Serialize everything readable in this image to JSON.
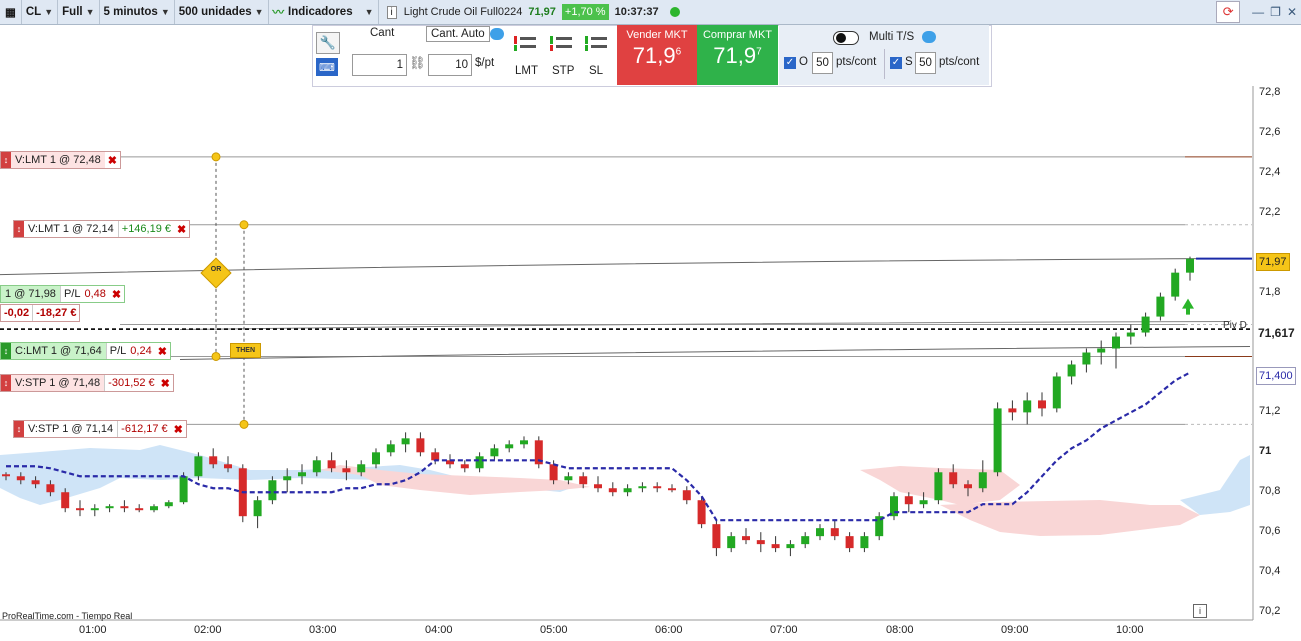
{
  "toolbar": {
    "symbol": "CL",
    "view": "Full",
    "timeframe": "5 minutos",
    "units": "500 unidades",
    "indicators": "Indicadores",
    "instrument": "Light Crude Oil Full0224",
    "price": "71,97",
    "change": "+1,70 %",
    "time": "10:37:37"
  },
  "order_panel": {
    "cant_label": "Cant",
    "cant_auto_label": "Cant. Auto",
    "quantity": "1",
    "dollar_per_pt": "10",
    "dollar_per_pt_unit": "$/pt",
    "lmt_label": "LMT",
    "stp_label": "STP",
    "sl_label": "SL",
    "sell_label": "Vender MKT",
    "sell_price_main": "71,9",
    "sell_price_sup": "6",
    "buy_label": "Comprar MKT",
    "buy_price_main": "71,9",
    "buy_price_sup": "7",
    "multi_ts_label": "Multi T/S",
    "o_label": "O",
    "o_value": "50",
    "s_label": "S",
    "s_value": "50",
    "pts_cont": "pts/cont"
  },
  "orders": {
    "o1": "V:LMT  1  @  72,48",
    "o2": "V:LMT  1  @  72,14",
    "o2_pl": "+146,19 €",
    "pos_main": "1  @  71,98",
    "pos_pl_label": "P/L",
    "pos_pl": "0,48",
    "pos_pts": "-0,02",
    "pos_eur": "-18,27 €",
    "o3": "C:LMT  1  @  71,64",
    "o3_pl_label": "P/L",
    "o3_pl": "0,24",
    "o4": "V:STP  1  @  71,48",
    "o4_pl": "-301,52 €",
    "o5": "V:STP  1  @  71,14",
    "o5_pl": "-612,17 €",
    "or_label": "OR",
    "then_label": "THEN"
  },
  "y_axis": [
    "72,8",
    "72,6",
    "72,4",
    "72,2",
    "71,8",
    "71,2",
    "71",
    "70,8",
    "70,6",
    "70,4",
    "70,2"
  ],
  "price_tags": {
    "last": "71,97",
    "pivot": "71,617",
    "pivot_label": "Piv D",
    "stop_line": "71,400"
  },
  "x_axis": [
    "01:00",
    "02:00",
    "03:00",
    "04:00",
    "05:00",
    "06:00",
    "07:00",
    "08:00",
    "09:00",
    "10:00"
  ],
  "footer": "ProRealTime.com - Tiempo Real",
  "colors": {
    "up": "#22a822",
    "down": "#d62a2a",
    "cloud_blue": "#cfe4f7",
    "cloud_red": "#f9d6d6",
    "stop_line": "#2a2aa8",
    "accent": "#2a66c8"
  },
  "chart_data": {
    "type": "candlestick",
    "ylim": [
      70.2,
      72.8
    ],
    "candles": [
      [
        0,
        70.89,
        70.9,
        70.86,
        70.88
      ],
      [
        1,
        70.88,
        70.9,
        70.84,
        70.86
      ],
      [
        2,
        70.86,
        70.88,
        70.82,
        70.84
      ],
      [
        3,
        70.84,
        70.86,
        70.78,
        70.8
      ],
      [
        4,
        70.8,
        70.82,
        70.7,
        70.72
      ],
      [
        5,
        70.72,
        70.76,
        70.68,
        70.71
      ],
      [
        6,
        70.71,
        70.74,
        70.68,
        70.72
      ],
      [
        7,
        70.72,
        70.74,
        70.7,
        70.73
      ],
      [
        8,
        70.73,
        70.76,
        70.7,
        70.72
      ],
      [
        9,
        70.72,
        70.74,
        70.7,
        70.71
      ],
      [
        10,
        70.71,
        70.74,
        70.7,
        70.73
      ],
      [
        11,
        70.73,
        70.76,
        70.72,
        70.75
      ],
      [
        12,
        70.75,
        70.9,
        70.74,
        70.88
      ],
      [
        13,
        70.88,
        71.0,
        70.86,
        70.98
      ],
      [
        14,
        70.98,
        71.02,
        70.92,
        70.94
      ],
      [
        15,
        70.94,
        70.98,
        70.9,
        70.92
      ],
      [
        16,
        70.92,
        70.94,
        70.65,
        70.68
      ],
      [
        17,
        70.68,
        70.78,
        70.62,
        70.76
      ],
      [
        18,
        70.76,
        70.88,
        70.74,
        70.86
      ],
      [
        19,
        70.86,
        70.92,
        70.8,
        70.88
      ],
      [
        20,
        70.88,
        70.94,
        70.84,
        70.9
      ],
      [
        21,
        70.9,
        70.98,
        70.88,
        70.96
      ],
      [
        22,
        70.96,
        71.0,
        70.9,
        70.92
      ],
      [
        23,
        70.92,
        70.96,
        70.86,
        70.9
      ],
      [
        24,
        70.9,
        70.96,
        70.88,
        70.94
      ],
      [
        25,
        70.94,
        71.02,
        70.92,
        71.0
      ],
      [
        26,
        71.0,
        71.06,
        70.98,
        71.04
      ],
      [
        27,
        71.04,
        71.1,
        71.0,
        71.07
      ],
      [
        28,
        71.07,
        71.1,
        70.98,
        71.0
      ],
      [
        29,
        71.0,
        71.02,
        70.94,
        70.96
      ],
      [
        30,
        70.96,
        70.99,
        70.92,
        70.94
      ],
      [
        31,
        70.94,
        70.96,
        70.9,
        70.92
      ],
      [
        32,
        70.92,
        71.0,
        70.9,
        70.98
      ],
      [
        33,
        70.98,
        71.04,
        70.96,
        71.02
      ],
      [
        34,
        71.02,
        71.06,
        71.0,
        71.04
      ],
      [
        35,
        71.04,
        71.08,
        71.02,
        71.06
      ],
      [
        36,
        71.06,
        71.08,
        70.92,
        70.94
      ],
      [
        37,
        70.94,
        70.96,
        70.84,
        70.86
      ],
      [
        38,
        70.86,
        70.9,
        70.84,
        70.88
      ],
      [
        39,
        70.88,
        70.9,
        70.82,
        70.84
      ],
      [
        40,
        70.84,
        70.88,
        70.8,
        70.82
      ],
      [
        41,
        70.82,
        70.85,
        70.78,
        70.8
      ],
      [
        42,
        70.8,
        70.84,
        70.78,
        70.82
      ],
      [
        43,
        70.82,
        70.85,
        70.8,
        70.83
      ],
      [
        44,
        70.83,
        70.85,
        70.8,
        70.82
      ],
      [
        45,
        70.82,
        70.84,
        70.8,
        70.81
      ],
      [
        46,
        70.81,
        70.83,
        70.74,
        70.76
      ],
      [
        47,
        70.76,
        70.78,
        70.62,
        70.64
      ],
      [
        48,
        70.64,
        70.66,
        70.48,
        70.52
      ],
      [
        49,
        70.52,
        70.6,
        70.5,
        70.58
      ],
      [
        50,
        70.58,
        70.62,
        70.54,
        70.56
      ],
      [
        51,
        70.56,
        70.6,
        70.5,
        70.54
      ],
      [
        52,
        70.54,
        70.58,
        70.5,
        70.52
      ],
      [
        53,
        70.52,
        70.56,
        70.48,
        70.54
      ],
      [
        54,
        70.54,
        70.6,
        70.52,
        70.58
      ],
      [
        55,
        70.58,
        70.64,
        70.56,
        70.62
      ],
      [
        56,
        70.62,
        70.66,
        70.56,
        70.58
      ],
      [
        57,
        70.58,
        70.6,
        70.5,
        70.52
      ],
      [
        58,
        70.52,
        70.6,
        70.5,
        70.58
      ],
      [
        59,
        70.58,
        70.7,
        70.56,
        70.68
      ],
      [
        60,
        70.68,
        70.8,
        70.66,
        70.78
      ],
      [
        61,
        70.78,
        70.8,
        70.7,
        70.74
      ],
      [
        62,
        70.74,
        70.8,
        70.72,
        70.76
      ],
      [
        63,
        70.76,
        70.92,
        70.74,
        70.9
      ],
      [
        64,
        70.9,
        70.94,
        70.82,
        70.84
      ],
      [
        65,
        70.84,
        70.86,
        70.78,
        70.82
      ],
      [
        66,
        70.82,
        70.96,
        70.8,
        70.9
      ],
      [
        67,
        70.9,
        71.25,
        70.88,
        71.22
      ],
      [
        68,
        71.22,
        71.26,
        71.16,
        71.2
      ],
      [
        69,
        71.2,
        71.3,
        71.14,
        71.26
      ],
      [
        70,
        71.26,
        71.3,
        71.18,
        71.22
      ],
      [
        71,
        71.22,
        71.4,
        71.2,
        71.38
      ],
      [
        72,
        71.38,
        71.46,
        71.34,
        71.44
      ],
      [
        73,
        71.44,
        71.52,
        71.4,
        71.5
      ],
      [
        74,
        71.5,
        71.56,
        71.44,
        71.52
      ],
      [
        75,
        71.52,
        71.6,
        71.42,
        71.58
      ],
      [
        76,
        71.58,
        71.64,
        71.54,
        71.6
      ],
      [
        77,
        71.6,
        71.7,
        71.58,
        71.68
      ],
      [
        78,
        71.68,
        71.8,
        71.66,
        71.78
      ],
      [
        79,
        71.78,
        71.92,
        71.76,
        71.9
      ],
      [
        80,
        71.9,
        71.98,
        71.86,
        71.97
      ]
    ],
    "ohlc_format": [
      "index",
      "open",
      "high",
      "low",
      "close"
    ],
    "stop_curve": [
      70.93,
      70.93,
      70.93,
      70.92,
      70.9,
      70.88,
      70.88,
      70.88,
      70.88,
      70.88,
      70.88,
      70.88,
      70.88,
      70.84,
      70.82,
      70.82,
      70.8,
      70.8,
      70.8,
      70.8,
      70.8,
      70.8,
      70.8,
      70.82,
      70.82,
      70.84,
      70.84,
      70.86,
      70.9,
      70.96,
      70.96,
      70.96,
      70.96,
      70.96,
      70.96,
      70.96,
      70.96,
      70.94,
      70.92,
      70.92,
      70.92,
      70.92,
      70.92,
      70.92,
      70.92,
      70.92,
      70.86,
      70.78,
      70.66,
      70.66,
      70.66,
      70.66,
      70.66,
      70.66,
      70.66,
      70.66,
      70.66,
      70.66,
      70.66,
      70.66,
      70.7,
      70.7,
      70.7,
      70.7,
      70.7,
      70.7,
      70.74,
      70.74,
      70.74,
      70.8,
      70.88,
      70.96,
      71.02,
      71.06,
      71.12,
      71.16,
      71.2,
      71.24,
      71.3,
      71.36,
      71.4
    ],
    "order_levels": [
      72.48,
      72.14,
      71.98,
      71.64,
      71.48,
      71.14
    ],
    "pivot": 71.617
  }
}
